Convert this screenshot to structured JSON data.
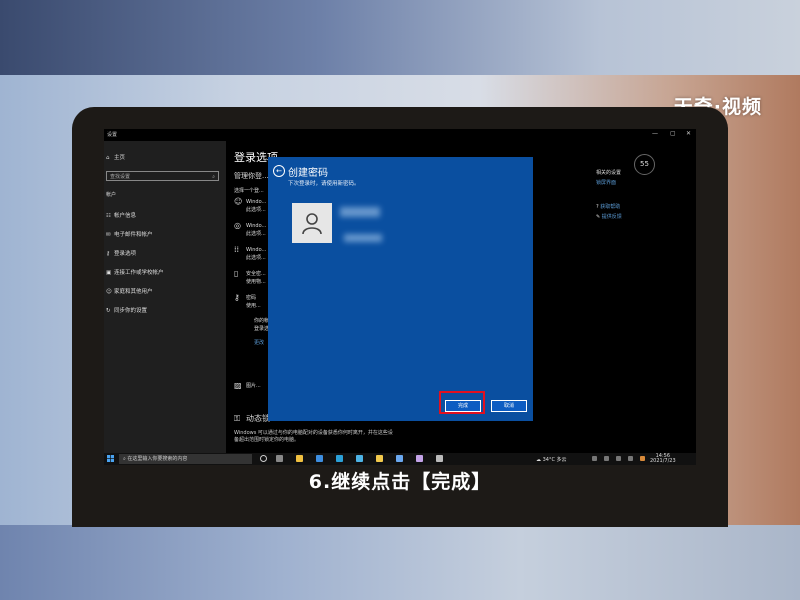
{
  "watermark": "天奇·视频",
  "caption": "6.继续点击【完成】",
  "window": {
    "title": "设置",
    "min": "—",
    "max": "▢",
    "close": "✕"
  },
  "left_nav": {
    "home": "主页",
    "search_placeholder": "查找设置",
    "section": "帐户",
    "items": [
      "帐户信息",
      "电子邮件和帐户",
      "登录选项",
      "连接工作或学校帐户",
      "家庭和其他用户",
      "同步你的设置"
    ]
  },
  "main": {
    "title": "登录选项",
    "subtitle": "管理你登...",
    "choose": "选择一个登...",
    "options": [
      {
        "icon": "face-icon",
        "glyph": "☺",
        "line1": "Windo...",
        "line2": "此选项..."
      },
      {
        "icon": "fingerprint-icon",
        "glyph": "◎",
        "line1": "Windo...",
        "line2": "此选项..."
      },
      {
        "icon": "pin-icon",
        "glyph": "⁞⁞",
        "line1": "Windo...",
        "line2": "此选项..."
      },
      {
        "icon": "security-key-icon",
        "glyph": "▯",
        "line1": "安全密...",
        "line2": "使用物..."
      },
      {
        "icon": "key-icon",
        "glyph": "⚷",
        "line1": "密码",
        "line2": "使用..."
      }
    ],
    "password_detail": [
      "你的帐...",
      "登录选...",
      "",
      "更改"
    ],
    "picture_password": "图片...",
    "dynamic_lock_title": "动态锁",
    "dynamic_lock_desc1": "Windows 可以通过与你的电脑配对的设备获悉你何时离开，并在这些设",
    "dynamic_lock_desc2": "备超出范围时锁定你的电脑。"
  },
  "right": {
    "badge": "55",
    "title": "相关的设置",
    "link1": "锁屏界面",
    "help1": "获取帮助",
    "help2": "提供反馈"
  },
  "dialog": {
    "title": "创建密码",
    "subtitle": "下次登录时，请使用新密码。",
    "done_label": "完成",
    "cancel_label": "取消"
  },
  "taskbar": {
    "search_placeholder": "在这里输入你要搜索的内容",
    "weather": "34°C 多云",
    "time": "14:56",
    "date": "2021/7/23"
  }
}
